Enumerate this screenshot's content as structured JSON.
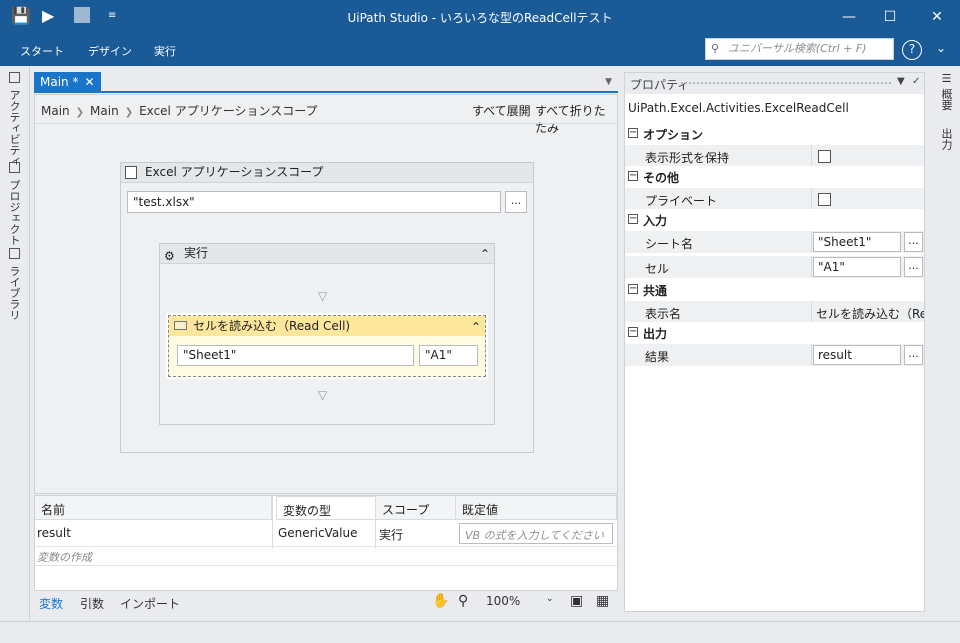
{
  "window": {
    "title": "UiPath Studio - いろいろな型のReadCellテスト"
  },
  "ribbon": {
    "tabs": [
      "スタート",
      "デザイン",
      "実行"
    ],
    "search_placeholder": "ユニバーサル検索(Ctrl + F)"
  },
  "left_rail": {
    "tabs": [
      "アクティビティ",
      "プロジェクト",
      "ライブラリ"
    ]
  },
  "right_rail": {
    "tabs": [
      "概要",
      "出力"
    ]
  },
  "document": {
    "tab_label": "Main *",
    "breadcrumb": [
      "Main",
      "Main",
      "Excel アプリケーションスコープ"
    ],
    "expand_all": "すべて展開",
    "collapse_all": "すべて折りたたみ"
  },
  "designer": {
    "scope": {
      "title": "Excel アプリケーションスコープ",
      "path_value": "\"test.xlsx\"",
      "browse_label": "..."
    },
    "do_block": {
      "title": "実行"
    },
    "read_cell": {
      "title": "セルを読み込む（Read Cell)",
      "sheet_value": "\"Sheet1\"",
      "cell_value": "\"A1\""
    }
  },
  "variables": {
    "columns": [
      "名前",
      "変数の型",
      "スコープ",
      "既定値"
    ],
    "rows": [
      {
        "name": "result",
        "type": "GenericValue",
        "scope": "実行",
        "default_placeholder": "VB の式を入力してください"
      }
    ],
    "create_label": "変数の作成"
  },
  "bottom_bar": {
    "tabs": [
      "変数",
      "引数",
      "インポート"
    ],
    "zoom": "100%"
  },
  "properties": {
    "panel_title": "プロパティ",
    "class_name": "UiPath.Excel.Activities.ExcelReadCell",
    "categories": [
      {
        "name": "オプション",
        "items": [
          {
            "label": "表示形式を保持",
            "kind": "checkbox"
          }
        ]
      },
      {
        "name": "その他",
        "items": [
          {
            "label": "プライベート",
            "kind": "checkbox"
          }
        ]
      },
      {
        "name": "入力",
        "items": [
          {
            "label": "シート名",
            "kind": "input",
            "value": "\"Sheet1\""
          },
          {
            "label": "セル",
            "kind": "input",
            "value": "\"A1\""
          }
        ]
      },
      {
        "name": "共通",
        "items": [
          {
            "label": "表示名",
            "kind": "text",
            "value": "セルを読み込む（Reac"
          }
        ]
      },
      {
        "name": "出力",
        "items": [
          {
            "label": "結果",
            "kind": "input",
            "value": "result"
          }
        ]
      }
    ],
    "browse_label": "..."
  },
  "colors": {
    "title_bar": "#1a5a96",
    "tab_accent": "#1a75c9",
    "read_cell_header": "#fde79c"
  }
}
